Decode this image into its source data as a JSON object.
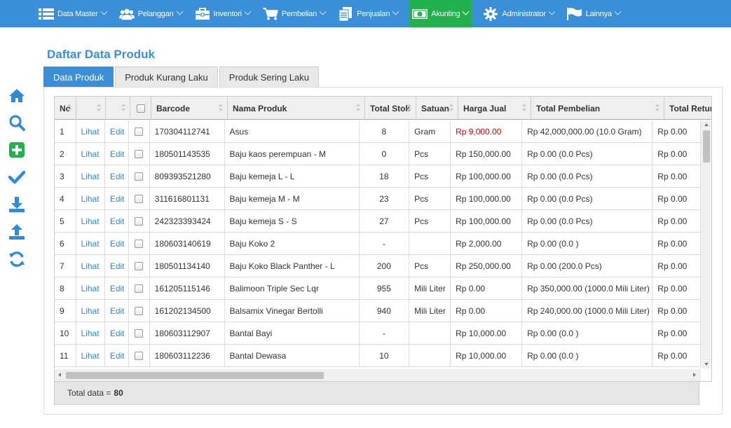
{
  "navbar": {
    "items": [
      {
        "label": "Data Master",
        "icon": "list-icon"
      },
      {
        "label": "Pelanggan",
        "icon": "users-icon"
      },
      {
        "label": "Inventori",
        "icon": "briefcase-icon"
      },
      {
        "label": "Pembelian",
        "icon": "cart-icon"
      },
      {
        "label": "Penjualan",
        "icon": "document-icon"
      },
      {
        "label": "Akunting",
        "icon": "money-icon"
      },
      {
        "label": "Administrator",
        "icon": "gear-icon"
      },
      {
        "label": "Lainnya",
        "icon": "flag-icon"
      }
    ],
    "active": "Akunting",
    "colors": {
      "bar": "#3a8fd8",
      "active": "#22b14c"
    }
  },
  "sidebar": {
    "icons": [
      "home-icon",
      "search-icon",
      "add-icon",
      "check-icon",
      "download-icon",
      "upload-icon",
      "refresh-icon"
    ]
  },
  "page": {
    "title": "Daftar Data Produk"
  },
  "tabs": [
    {
      "label": "Data Produk",
      "active": true
    },
    {
      "label": "Produk Kurang Laku",
      "active": false
    },
    {
      "label": "Produk Sering Laku",
      "active": false
    }
  ],
  "table": {
    "columns": [
      {
        "label": "No"
      },
      {
        "label": ""
      },
      {
        "label": ""
      },
      {
        "label": ""
      },
      {
        "label": "Barcode"
      },
      {
        "label": "Nama Produk"
      },
      {
        "label": "Total Stok"
      },
      {
        "label": "Satuan"
      },
      {
        "label": "Harga Jual"
      },
      {
        "label": "Total Pembelian"
      },
      {
        "label": "Total Retur"
      }
    ],
    "view_label": "Lihat",
    "edit_label": "Edit",
    "rows": [
      {
        "no": "1",
        "barcode": "170304112741",
        "nama": "Asus",
        "stok": "8",
        "satuan": "Gram",
        "harga": "Rp 9,000.00",
        "pembelian": "Rp 42,000,000.00 (10.0 Gram)",
        "retur": "Rp 0.00",
        "harga_highlight": true
      },
      {
        "no": "2",
        "barcode": "180501143535",
        "nama": "Baju kaos perempuan - M",
        "stok": "0",
        "satuan": "Pcs",
        "harga": "Rp 150,000.00",
        "pembelian": "Rp 0.00 (0.0 Pcs)",
        "retur": "Rp 0.00"
      },
      {
        "no": "3",
        "barcode": "809393521280",
        "nama": "Baju kemeja L - L",
        "stok": "18",
        "satuan": "Pcs",
        "harga": "Rp 100,000.00",
        "pembelian": "Rp 0.00 (0.0 Pcs)",
        "retur": "Rp 0.00"
      },
      {
        "no": "4",
        "barcode": "311616801131",
        "nama": "Baju kemeja M - M",
        "stok": "23",
        "satuan": "Pcs",
        "harga": "Rp 100,000.00",
        "pembelian": "Rp 0.00 (0.0 Pcs)",
        "retur": "Rp 0.00"
      },
      {
        "no": "5",
        "barcode": "242323393424",
        "nama": "Baju kemeja S - S",
        "stok": "27",
        "satuan": "Pcs",
        "harga": "Rp 100,000.00",
        "pembelian": "Rp 0.00 (0.0 Pcs)",
        "retur": "Rp 0.00"
      },
      {
        "no": "6",
        "barcode": "180603140619",
        "nama": "Baju Koko 2",
        "stok": "-",
        "satuan": "",
        "harga": "Rp 2,000.00",
        "pembelian": "Rp 0.00 (0.0 )",
        "retur": "Rp 0.00"
      },
      {
        "no": "7",
        "barcode": "180501134140",
        "nama": "Baju Koko Black Panther - L",
        "stok": "200",
        "satuan": "Pcs",
        "harga": "Rp 250,000.00",
        "pembelian": "Rp 0.00 (200.0 Pcs)",
        "retur": "Rp 0.00"
      },
      {
        "no": "8",
        "barcode": "161205115146",
        "nama": "Balimoon Triple Sec Lqr",
        "stok": "955",
        "satuan": "Mili Liter",
        "harga": "Rp 0.00",
        "pembelian": "Rp 350,000.00 (1000.0 Mili Liter)",
        "retur": "Rp 0.00"
      },
      {
        "no": "9",
        "barcode": "161202134500",
        "nama": "Balsamix Vinegar Bertolli",
        "stok": "940",
        "satuan": "Mili Liter",
        "harga": "Rp 0.00",
        "pembelian": "Rp 240,000.00 (1000.0 Mili Liter)",
        "retur": "Rp 0.00"
      },
      {
        "no": "10",
        "barcode": "180603112907",
        "nama": "Bantal Bayi",
        "stok": "-",
        "satuan": "",
        "harga": "Rp 10,000.00",
        "pembelian": "Rp 0.00 (0.0 )",
        "retur": "Rp 0.00"
      },
      {
        "no": "11",
        "barcode": "180603112236",
        "nama": "Bantal Dewasa",
        "stok": "10",
        "satuan": "",
        "harga": "Rp 10,000.00",
        "pembelian": "Rp 0.00 (0.0 )",
        "retur": "Rp 0.00"
      }
    ]
  },
  "footer": {
    "total_label": "Total data =",
    "total_value": "80"
  }
}
